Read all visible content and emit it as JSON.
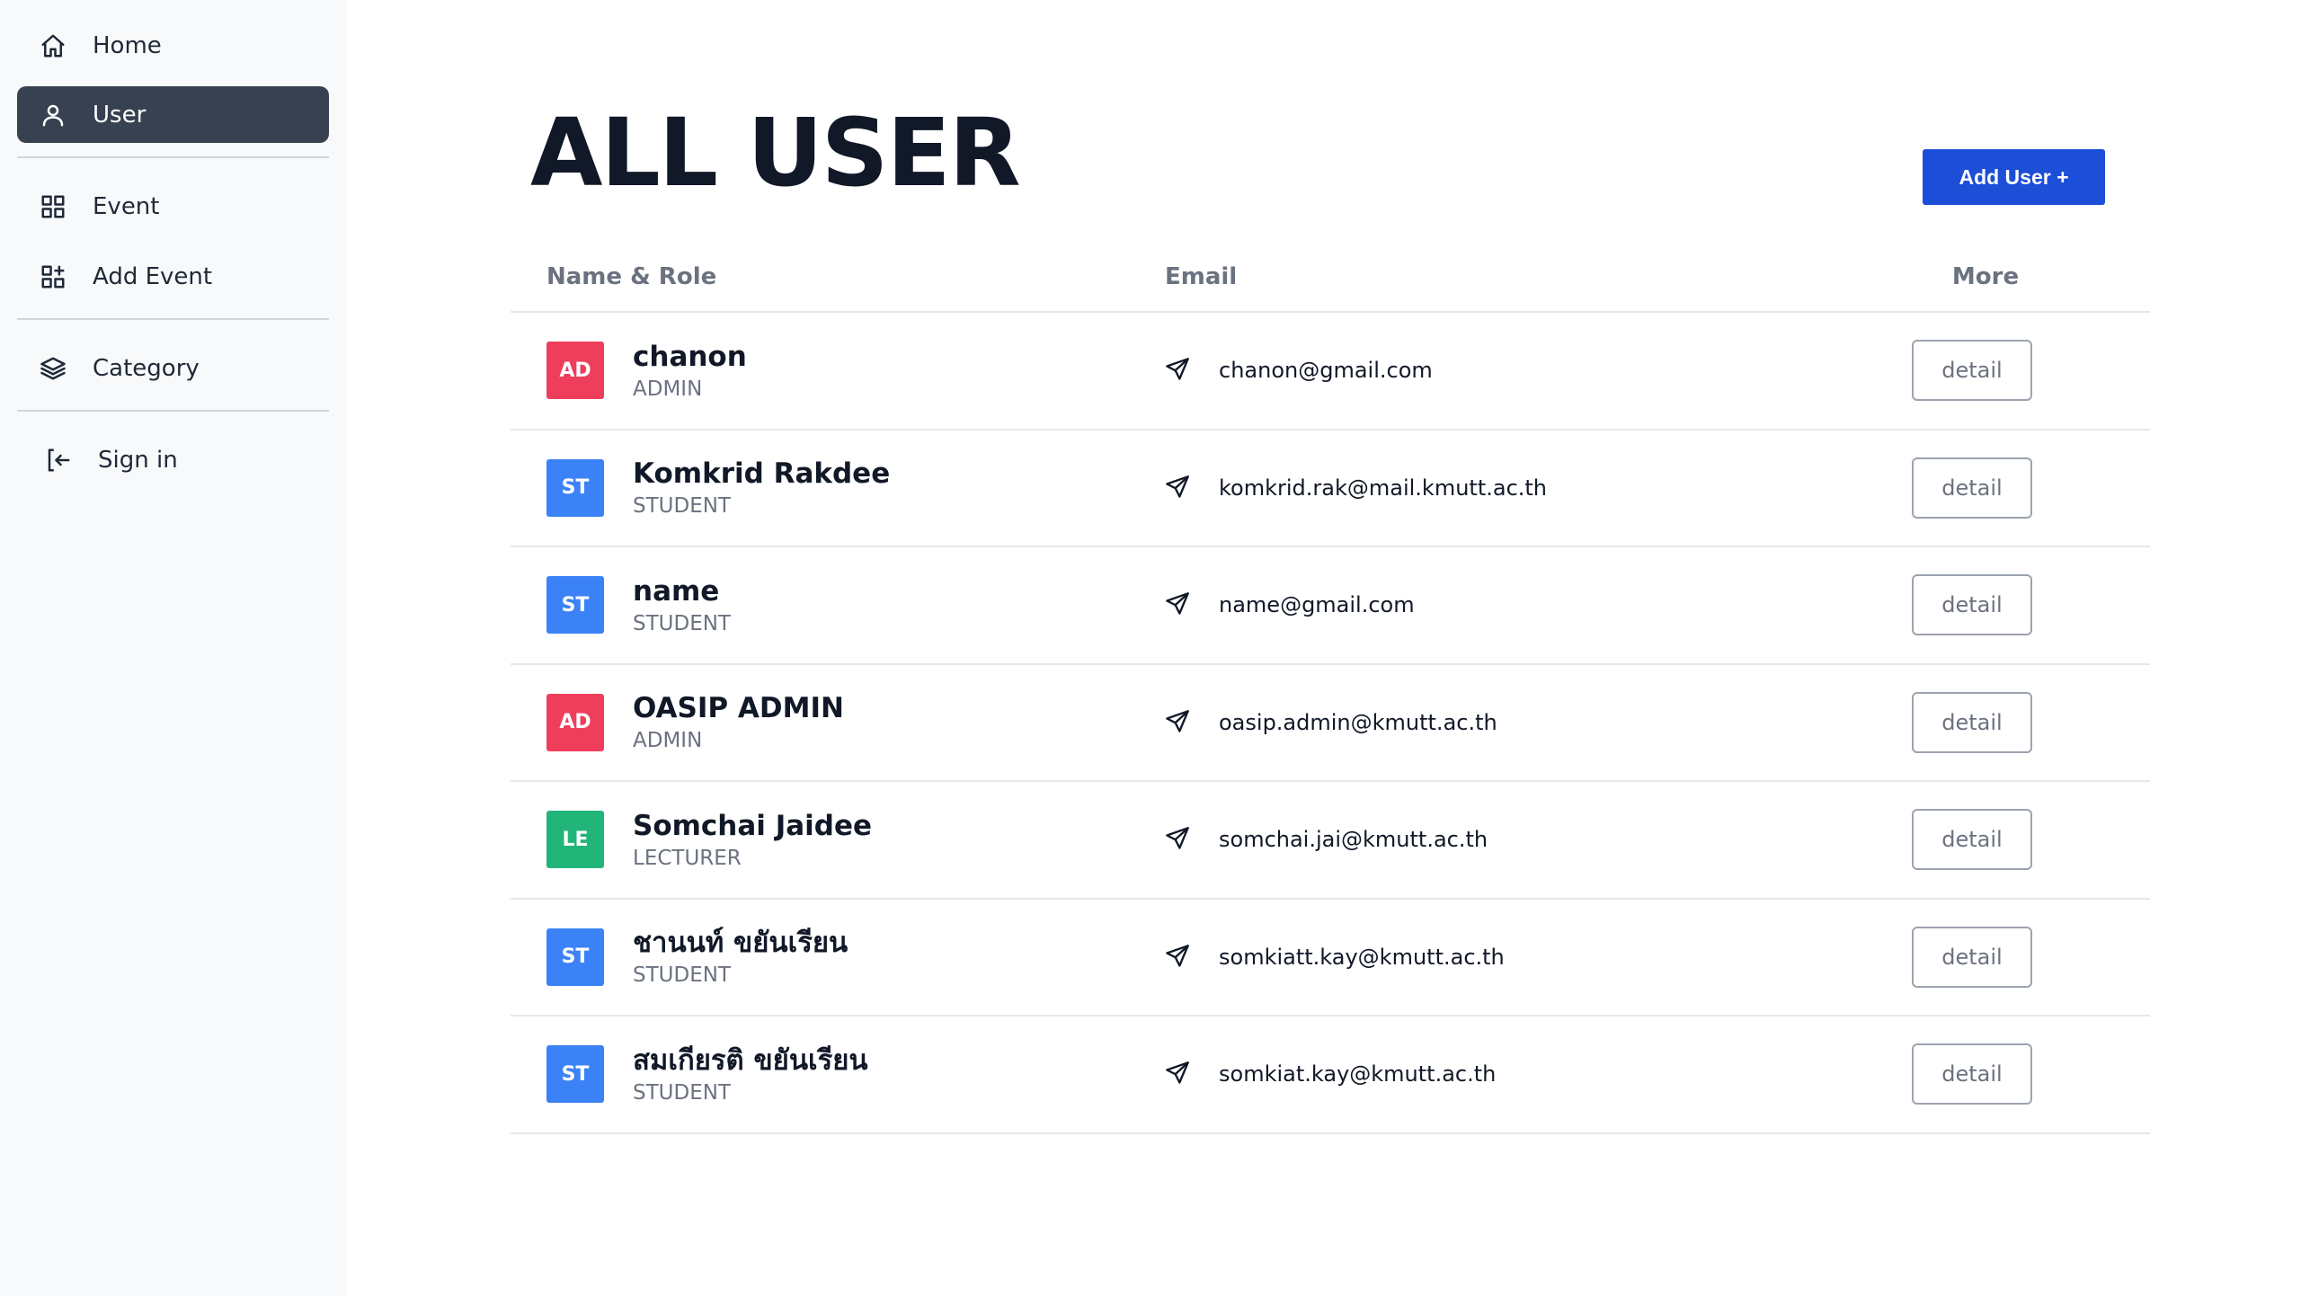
{
  "sidebar": {
    "items": [
      {
        "label": "Home",
        "icon": "home-icon"
      },
      {
        "label": "User",
        "icon": "user-icon",
        "active": true
      },
      {
        "label": "Event",
        "icon": "grid-icon"
      },
      {
        "label": "Add Event",
        "icon": "grid-add-icon"
      },
      {
        "label": "Category",
        "icon": "layers-icon"
      },
      {
        "label": "Sign in",
        "icon": "sign-in-icon"
      }
    ]
  },
  "page": {
    "title": "ALL USER",
    "add_button": "Add User +"
  },
  "table": {
    "headers": {
      "name_role": "Name & Role",
      "email": "Email",
      "more": "More"
    },
    "detail_label": "detail",
    "rows": [
      {
        "initials": "AD",
        "name": "chanon",
        "role": "ADMIN",
        "email": "chanon@gmail.com"
      },
      {
        "initials": "ST",
        "name": "Komkrid Rakdee",
        "role": "STUDENT",
        "email": "komkrid.rak@mail.kmutt.ac.th"
      },
      {
        "initials": "ST",
        "name": "name",
        "role": "STUDENT",
        "email": "name@gmail.com"
      },
      {
        "initials": "AD",
        "name": "OASIP ADMIN",
        "role": "ADMIN",
        "email": "oasip.admin@kmutt.ac.th"
      },
      {
        "initials": "LE",
        "name": "Somchai Jaidee",
        "role": "LECTURER",
        "email": "somchai.jai@kmutt.ac.th"
      },
      {
        "initials": "ST",
        "name": "ชานนท์ ขยันเรียน",
        "role": "STUDENT",
        "email": "somkiatt.kay@kmutt.ac.th"
      },
      {
        "initials": "ST",
        "name": "สมเกียรติ ขยันเรียน",
        "role": "STUDENT",
        "email": "somkiat.kay@kmutt.ac.th"
      }
    ]
  },
  "colors": {
    "admin": "#ef3e5c",
    "student": "#3b82f6",
    "lecturer": "#22b57a",
    "primary": "#1d4ed8",
    "sidebar_active": "#374151"
  }
}
